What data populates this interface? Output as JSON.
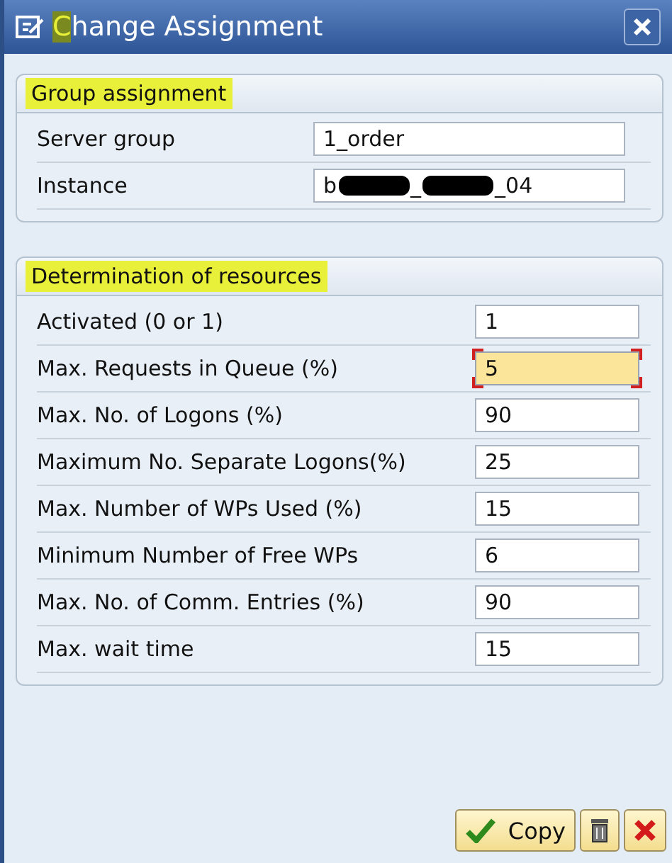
{
  "window": {
    "title": "Change Assignment",
    "title_first_letter_highlighted": true
  },
  "groups": [
    {
      "title": "Group assignment",
      "highlighted": true,
      "fields": [
        {
          "label": "Server group",
          "value_parts": [
            "1_order"
          ],
          "focused": false
        },
        {
          "label": "Instance",
          "value_parts": [
            "b",
            "_",
            "_04"
          ],
          "focused": false
        }
      ]
    },
    {
      "title": "Determination of resources",
      "highlighted": true,
      "fields": [
        {
          "label": "Activated (0 or 1)",
          "value_parts": [
            "1"
          ],
          "focused": false
        },
        {
          "label": "Max. Requests in Queue (%)",
          "value_parts": [
            "5"
          ],
          "focused": true
        },
        {
          "label": "Max. No. of Logons (%)",
          "value_parts": [
            "90"
          ],
          "focused": false
        },
        {
          "label": "Maximum No. Separate Logons(%)",
          "value_parts": [
            "25"
          ],
          "focused": false
        },
        {
          "label": "Max. Number of WPs Used (%)",
          "value_parts": [
            "15"
          ],
          "focused": false
        },
        {
          "label": "Minimum Number of Free WPs",
          "value_parts": [
            "6"
          ],
          "focused": false
        },
        {
          "label": "Max. No. of Comm. Entries (%)",
          "value_parts": [
            "90"
          ],
          "focused": false
        },
        {
          "label": "Max. wait time",
          "value_parts": [
            "15"
          ],
          "focused": false
        }
      ]
    }
  ],
  "buttons": [
    {
      "kind": "confirm",
      "label": "Copy"
    },
    {
      "kind": "delete"
    },
    {
      "kind": "cancel"
    }
  ]
}
